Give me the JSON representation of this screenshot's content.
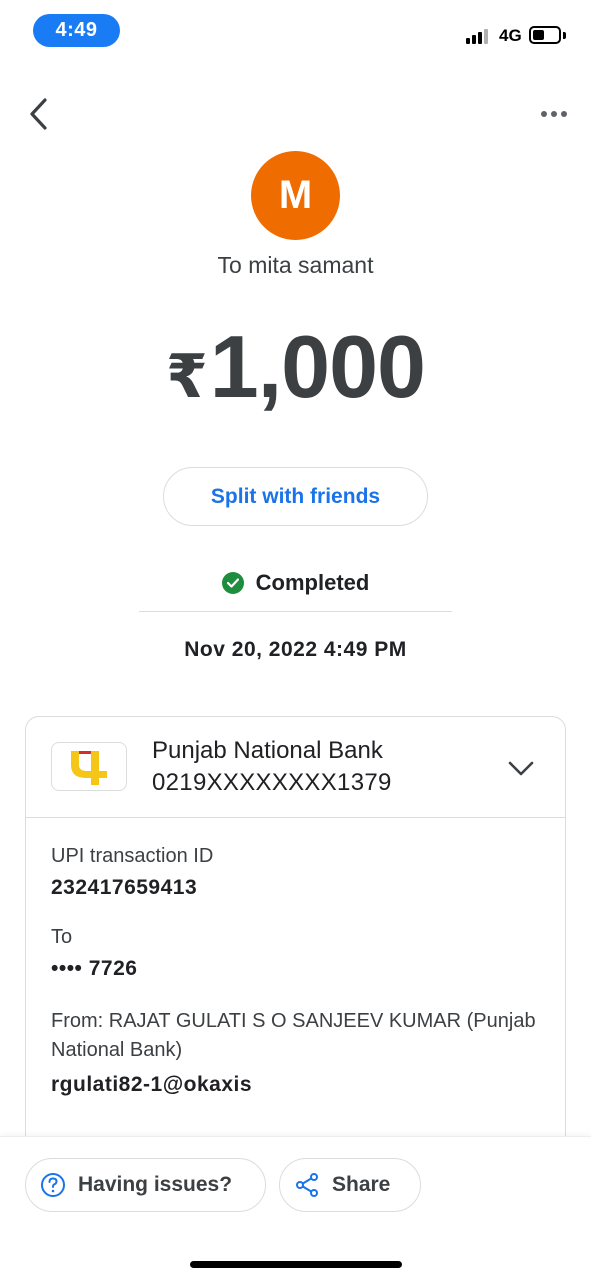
{
  "status_bar": {
    "time": "4:49",
    "network": "4G",
    "battery_level": 0.45
  },
  "nav": {
    "back_icon": "chevron-left-icon",
    "more_icon": "more-horizontal-icon"
  },
  "recipient": {
    "avatar_initial": "M",
    "avatar_color": "#ef6c00",
    "label": "To mita samant"
  },
  "amount": {
    "currency_symbol": "₹",
    "value": "1,000"
  },
  "split_button": {
    "label": "Split with friends"
  },
  "status": {
    "text": "Completed",
    "color": "#1e8e3e"
  },
  "datetime": "Nov 20, 2022 4:49 PM",
  "bank": {
    "name": "Punjab National Bank",
    "account": "0219XXXXXXXX1379",
    "logo_color": "#f5c518"
  },
  "details": {
    "upi_label": "UPI transaction ID",
    "upi_value": "232417659413",
    "to_label": "To",
    "to_value": "•••• 7726",
    "from_label": "From: RAJAT GULATI S O SANJEEV KUMAR (Punjab National Bank)",
    "from_value": "rgulati82-1@okaxis"
  },
  "bottom_actions": {
    "issues_label": "Having issues?",
    "share_label": "Share",
    "accent": "#1a73e8"
  }
}
